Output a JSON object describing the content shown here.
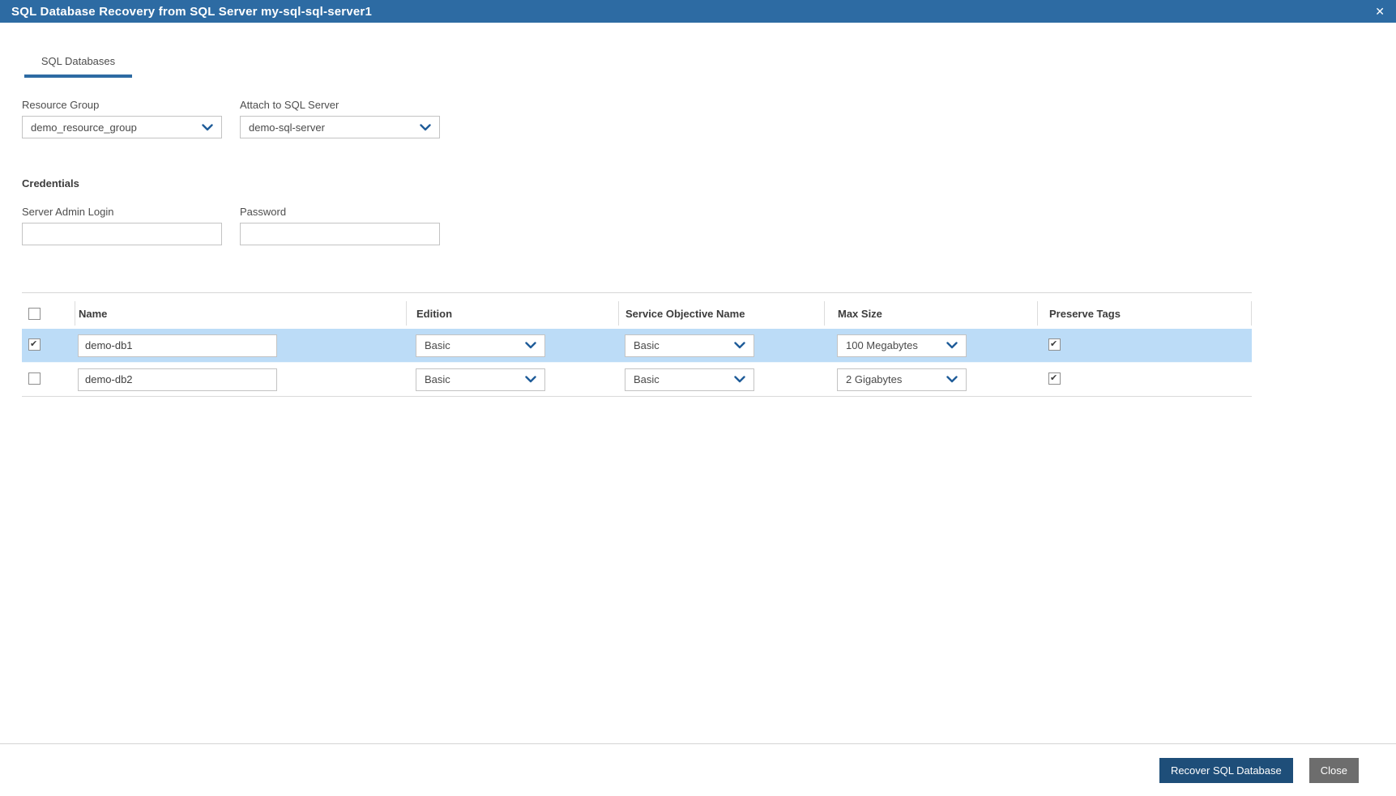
{
  "dialog": {
    "title": "SQL Database Recovery from SQL Server my-sql-sql-server1",
    "close_icon": "✕"
  },
  "tabs": [
    {
      "label": "SQL Databases",
      "active": true
    }
  ],
  "form": {
    "resource_group": {
      "label": "Resource Group",
      "value": "demo_resource_group"
    },
    "attach_to_sql_server": {
      "label": "Attach to SQL Server",
      "value": "demo-sql-server"
    },
    "credentials": {
      "heading": "Credentials",
      "server_admin_login": {
        "label": "Server Admin Login",
        "value": ""
      },
      "password": {
        "label": "Password",
        "value": ""
      }
    }
  },
  "table": {
    "columns": {
      "name": "Name",
      "edition": "Edition",
      "service_objective": "Service Objective Name",
      "max_size": "Max Size",
      "preserve_tags": "Preserve Tags"
    },
    "header_checkbox_checked": false,
    "rows": [
      {
        "selected": true,
        "name": "demo-db1",
        "edition": "Basic",
        "service_objective": "Basic",
        "max_size": "100 Megabytes",
        "preserve_tags": true
      },
      {
        "selected": false,
        "name": "demo-db2",
        "edition": "Basic",
        "service_objective": "Basic",
        "max_size": "2 Gigabytes",
        "preserve_tags": true
      }
    ]
  },
  "footer": {
    "recover_label": "Recover SQL Database",
    "close_label": "Close"
  },
  "colors": {
    "titlebar_bg": "#2d6ba3",
    "tab_underline": "#2d6ba3",
    "chevron": "#1f5c99",
    "row_highlight": "#bcdcf7",
    "recover_button_bg": "#1e4e79",
    "close_button_bg": "#6d6d6d"
  }
}
